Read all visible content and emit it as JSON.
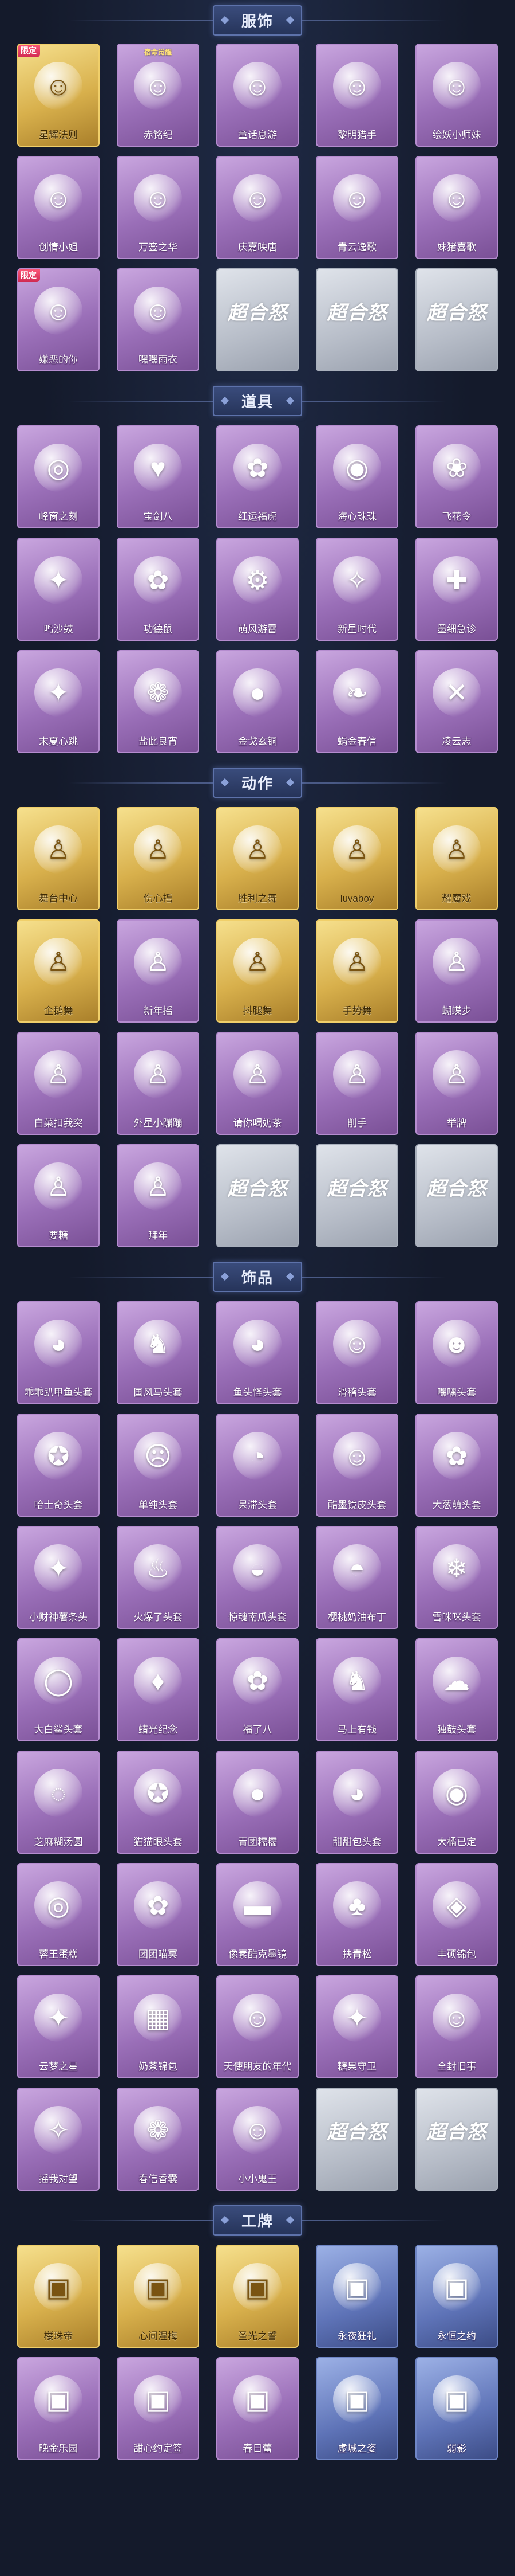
{
  "sections": [
    {
      "title": "服饰",
      "items": [
        {
          "label": "星辉法则",
          "style": "gold",
          "icon": "character-portrait-icon",
          "glyph": "☺",
          "badge": "限定"
        },
        {
          "label": "赤铭纪",
          "style": "purple",
          "icon": "character-portrait-icon",
          "glyph": "☺",
          "top_tag": "宿命觉醒"
        },
        {
          "label": "童话息游",
          "style": "purple",
          "icon": "character-portrait-icon",
          "glyph": "☺"
        },
        {
          "label": "黎明猎手",
          "style": "purple",
          "icon": "character-portrait-icon",
          "glyph": "☺"
        },
        {
          "label": "绘妖小师妹",
          "style": "purple",
          "icon": "character-portrait-icon",
          "glyph": "☺"
        },
        {
          "label": "创情小姐",
          "style": "purple",
          "icon": "character-portrait-icon",
          "glyph": "☺"
        },
        {
          "label": "万签之华",
          "style": "purple",
          "icon": "character-portrait-icon",
          "glyph": "☺"
        },
        {
          "label": "庆嘉映唐",
          "style": "purple",
          "icon": "character-portrait-icon",
          "glyph": "☺"
        },
        {
          "label": "青云逸歌",
          "style": "purple",
          "icon": "character-portrait-icon",
          "glyph": "☺"
        },
        {
          "label": "妹猪喜歌",
          "style": "purple",
          "icon": "character-portrait-icon",
          "glyph": "☺"
        },
        {
          "label": "嫌恶的你",
          "style": "purple",
          "icon": "character-portrait-icon",
          "glyph": "☺",
          "badge": "限定"
        },
        {
          "label": "嘿嘿雨衣",
          "style": "purple",
          "icon": "character-portrait-icon",
          "glyph": "☺"
        },
        {
          "label": "",
          "style": "placeholder",
          "icon": "superhuman-watermark-icon",
          "glyph": "超合怒"
        },
        {
          "label": "",
          "style": "placeholder",
          "icon": "superhuman-watermark-icon",
          "glyph": "超合怒"
        },
        {
          "label": "",
          "style": "placeholder",
          "icon": "superhuman-watermark-icon",
          "glyph": "超合怒"
        }
      ]
    },
    {
      "title": "道具",
      "items": [
        {
          "label": "峰窗之刻",
          "style": "purple",
          "icon": "necklace-icon",
          "glyph": "◎"
        },
        {
          "label": "宝剑八",
          "style": "purple",
          "icon": "heart-shield-icon",
          "glyph": "♥"
        },
        {
          "label": "红运福虎",
          "style": "purple",
          "icon": "tiger-plush-icon",
          "glyph": "✿"
        },
        {
          "label": "海心珠珠",
          "style": "purple",
          "icon": "pearl-shell-icon",
          "glyph": "◉"
        },
        {
          "label": "飞花令",
          "style": "purple",
          "icon": "flower-bouquet-icon",
          "glyph": "❀"
        },
        {
          "label": "鸣沙鼓",
          "style": "purple",
          "icon": "dreamcatcher-icon",
          "glyph": "✦"
        },
        {
          "label": "功德鼠",
          "style": "purple",
          "icon": "hamster-icon",
          "glyph": "✿"
        },
        {
          "label": "萌风游雷",
          "style": "purple",
          "icon": "robot-toy-icon",
          "glyph": "⚙"
        },
        {
          "label": "新星时代",
          "style": "purple",
          "icon": "revolver-icon",
          "glyph": "✧"
        },
        {
          "label": "墨细急诊",
          "style": "purple",
          "icon": "medkit-icon",
          "glyph": "✚"
        },
        {
          "label": "末夏心跳",
          "style": "purple",
          "icon": "magic-wand-icon",
          "glyph": "✦"
        },
        {
          "label": "盐此良宵",
          "style": "purple",
          "icon": "lotus-lamp-icon",
          "glyph": "❁"
        },
        {
          "label": "金戈玄铜",
          "style": "purple",
          "icon": "grenade-icon",
          "glyph": "●"
        },
        {
          "label": "蜗金春信",
          "style": "purple",
          "icon": "jade-leaf-icon",
          "glyph": "❧"
        },
        {
          "label": "凌云志",
          "style": "purple",
          "icon": "crossbow-icon",
          "glyph": "✕"
        }
      ]
    },
    {
      "title": "动作",
      "items": [
        {
          "label": "舞台中心",
          "style": "gold",
          "icon": "dance-pose-icon",
          "glyph": "♙"
        },
        {
          "label": "伤心摇",
          "style": "gold",
          "icon": "dance-pose-icon",
          "glyph": "♙"
        },
        {
          "label": "胜利之舞",
          "style": "gold",
          "icon": "dance-pose-icon",
          "glyph": "♙"
        },
        {
          "label": "luvaboy",
          "style": "gold",
          "icon": "dance-pose-icon",
          "glyph": "♙"
        },
        {
          "label": "耀魔戏",
          "style": "gold",
          "icon": "dance-pose-icon",
          "glyph": "♙"
        },
        {
          "label": "企鹅舞",
          "style": "gold",
          "icon": "dance-pose-icon",
          "glyph": "♙"
        },
        {
          "label": "新年摇",
          "style": "purple",
          "icon": "dance-pose-icon",
          "glyph": "♙"
        },
        {
          "label": "抖腿舞",
          "style": "gold",
          "icon": "dance-pose-icon",
          "glyph": "♙"
        },
        {
          "label": "手势舞",
          "style": "gold",
          "icon": "dance-pose-icon",
          "glyph": "♙"
        },
        {
          "label": "蝴蝶步",
          "style": "purple",
          "icon": "dance-pose-icon",
          "glyph": "♙"
        },
        {
          "label": "白菜扣我突",
          "style": "purple",
          "icon": "dance-pose-icon",
          "glyph": "♙"
        },
        {
          "label": "外星小蹦蹦",
          "style": "purple",
          "icon": "dance-pose-icon",
          "glyph": "♙"
        },
        {
          "label": "请你喝奶茶",
          "style": "purple",
          "icon": "dance-pose-icon",
          "glyph": "♙"
        },
        {
          "label": "削手",
          "style": "purple",
          "icon": "dance-pose-icon",
          "glyph": "♙"
        },
        {
          "label": "举牌",
          "style": "purple",
          "icon": "dance-pose-icon",
          "glyph": "♙"
        },
        {
          "label": "要糖",
          "style": "purple",
          "icon": "dance-pose-icon",
          "glyph": "♙"
        },
        {
          "label": "拜年",
          "style": "purple",
          "icon": "dance-pose-icon",
          "glyph": "♙"
        },
        {
          "label": "",
          "style": "placeholder",
          "icon": "superhuman-watermark-icon",
          "glyph": "超合怒"
        },
        {
          "label": "",
          "style": "placeholder",
          "icon": "superhuman-watermark-icon",
          "glyph": "超合怒"
        },
        {
          "label": "",
          "style": "placeholder",
          "icon": "superhuman-watermark-icon",
          "glyph": "超合怒"
        }
      ]
    },
    {
      "title": "饰品",
      "items": [
        {
          "label": "乖乖趴甲鱼头套",
          "style": "purple",
          "icon": "fish-headgear-icon",
          "glyph": "◕"
        },
        {
          "label": "国风马头套",
          "style": "purple",
          "icon": "horse-headgear-icon",
          "glyph": "♞"
        },
        {
          "label": "鱼头怪头套",
          "style": "purple",
          "icon": "fishman-headgear-icon",
          "glyph": "◕"
        },
        {
          "label": "滑稽头套",
          "style": "purple",
          "icon": "smiley-headgear-icon",
          "glyph": "☺"
        },
        {
          "label": "嘿嘿头套",
          "style": "purple",
          "icon": "grin-headgear-icon",
          "glyph": "☻"
        },
        {
          "label": "哈士奇头套",
          "style": "purple",
          "icon": "husky-headgear-icon",
          "glyph": "✪"
        },
        {
          "label": "单纯头套",
          "style": "purple",
          "icon": "emoji-headgear-icon",
          "glyph": "☹"
        },
        {
          "label": "呆滞头套",
          "style": "purple",
          "icon": "emoji-headgear-icon",
          "glyph": "◔"
        },
        {
          "label": "酷墨镜皮头套",
          "style": "purple",
          "icon": "sunglasses-headgear-icon",
          "glyph": "☺"
        },
        {
          "label": "大葱萌头套",
          "style": "purple",
          "icon": "scallion-headgear-icon",
          "glyph": "✿"
        },
        {
          "label": "小财神薯条头",
          "style": "purple",
          "icon": "fortune-headgear-icon",
          "glyph": "✦"
        },
        {
          "label": "火爆了头套",
          "style": "purple",
          "icon": "fire-headgear-icon",
          "glyph": "♨"
        },
        {
          "label": "惊魂南瓜头套",
          "style": "purple",
          "icon": "pumpkin-headgear-icon",
          "glyph": "◒"
        },
        {
          "label": "樱桃奶油布丁",
          "style": "purple",
          "icon": "pudding-headgear-icon",
          "glyph": "◓"
        },
        {
          "label": "雪咪咪头套",
          "style": "purple",
          "icon": "snow-headgear-icon",
          "glyph": "❄"
        },
        {
          "label": "大白鲨头套",
          "style": "purple",
          "icon": "egg-headgear-icon",
          "glyph": "◯"
        },
        {
          "label": "蜡光纪念",
          "style": "purple",
          "icon": "candle-headgear-icon",
          "glyph": "♦"
        },
        {
          "label": "福了八",
          "style": "purple",
          "icon": "bag-headgear-icon",
          "glyph": "✿"
        },
        {
          "label": "马上有钱",
          "style": "purple",
          "icon": "horse-money-icon",
          "glyph": "♞"
        },
        {
          "label": "独鼓头套",
          "style": "purple",
          "icon": "cloud-headgear-icon",
          "glyph": "☁"
        },
        {
          "label": "芝麻糊汤圆",
          "style": "purple",
          "icon": "dumpling-headgear-icon",
          "glyph": "◌"
        },
        {
          "label": "猫猫眼头套",
          "style": "purple",
          "icon": "cat-headgear-icon",
          "glyph": "✪"
        },
        {
          "label": "青团糯糯",
          "style": "purple",
          "icon": "green-bun-icon",
          "glyph": "●"
        },
        {
          "label": "甜甜包头套",
          "style": "purple",
          "icon": "bun-headgear-icon",
          "glyph": "◕"
        },
        {
          "label": "大橘已定",
          "style": "purple",
          "icon": "orange-headgear-icon",
          "glyph": "◉"
        },
        {
          "label": "蓉王蛋糕",
          "style": "purple",
          "icon": "cake-roll-icon",
          "glyph": "◎"
        },
        {
          "label": "团团喵冥",
          "style": "purple",
          "icon": "cat-plush-icon",
          "glyph": "✿"
        },
        {
          "label": "像素酷克墨镜",
          "style": "purple",
          "icon": "pixel-sunglasses-icon",
          "glyph": "▬"
        },
        {
          "label": "扶青松",
          "style": "purple",
          "icon": "bonsai-icon",
          "glyph": "♣"
        },
        {
          "label": "丰硕锦包",
          "style": "purple",
          "icon": "cake-backpack-icon",
          "glyph": "◈"
        },
        {
          "label": "云梦之星",
          "style": "purple",
          "icon": "rainbow-cat-icon",
          "glyph": "✦"
        },
        {
          "label": "奶茶锦包",
          "style": "purple",
          "icon": "milk-tea-icon",
          "glyph": "▦"
        },
        {
          "label": "天使朋友的年代",
          "style": "purple",
          "icon": "photo-locket-icon",
          "glyph": "☺"
        },
        {
          "label": "糖果守卫",
          "style": "purple",
          "icon": "candy-icon",
          "glyph": "✦"
        },
        {
          "label": "全封旧事",
          "style": "purple",
          "icon": "doll-charm-icon",
          "glyph": "☺"
        },
        {
          "label": "摇我对望",
          "style": "purple",
          "icon": "crystal-charm-icon",
          "glyph": "✧"
        },
        {
          "label": "春信香囊",
          "style": "purple",
          "icon": "sachet-icon",
          "glyph": "❁"
        },
        {
          "label": "小小鬼王",
          "style": "purple",
          "icon": "ghost-king-icon",
          "glyph": "☺"
        },
        {
          "label": "",
          "style": "placeholder",
          "icon": "superhuman-watermark-icon",
          "glyph": "超合怒"
        },
        {
          "label": "",
          "style": "placeholder",
          "icon": "superhuman-watermark-icon",
          "glyph": "超合怒"
        }
      ]
    },
    {
      "title": "工牌",
      "items": [
        {
          "label": "楼珠帝",
          "style": "gold",
          "icon": "badge-card-icon",
          "glyph": "▣"
        },
        {
          "label": "心间涅梅",
          "style": "gold",
          "icon": "badge-card-icon",
          "glyph": "▣"
        },
        {
          "label": "圣光之誓",
          "style": "gold",
          "icon": "badge-card-icon",
          "glyph": "▣"
        },
        {
          "label": "永夜狂礼",
          "style": "blue",
          "icon": "badge-card-icon",
          "glyph": "▣"
        },
        {
          "label": "永恒之约",
          "style": "blue",
          "icon": "badge-card-icon",
          "glyph": "▣"
        },
        {
          "label": "晚金乐园",
          "style": "purple",
          "icon": "badge-card-icon",
          "glyph": "▣"
        },
        {
          "label": "甜心约定签",
          "style": "purple",
          "icon": "badge-card-icon",
          "glyph": "▣"
        },
        {
          "label": "春日蕾",
          "style": "purple",
          "icon": "badge-card-icon",
          "glyph": "▣"
        },
        {
          "label": "虚城之姿",
          "style": "blue",
          "icon": "badge-card-icon",
          "glyph": "▣"
        },
        {
          "label": "弱影",
          "style": "blue",
          "icon": "badge-card-icon",
          "glyph": "▣"
        }
      ]
    }
  ]
}
